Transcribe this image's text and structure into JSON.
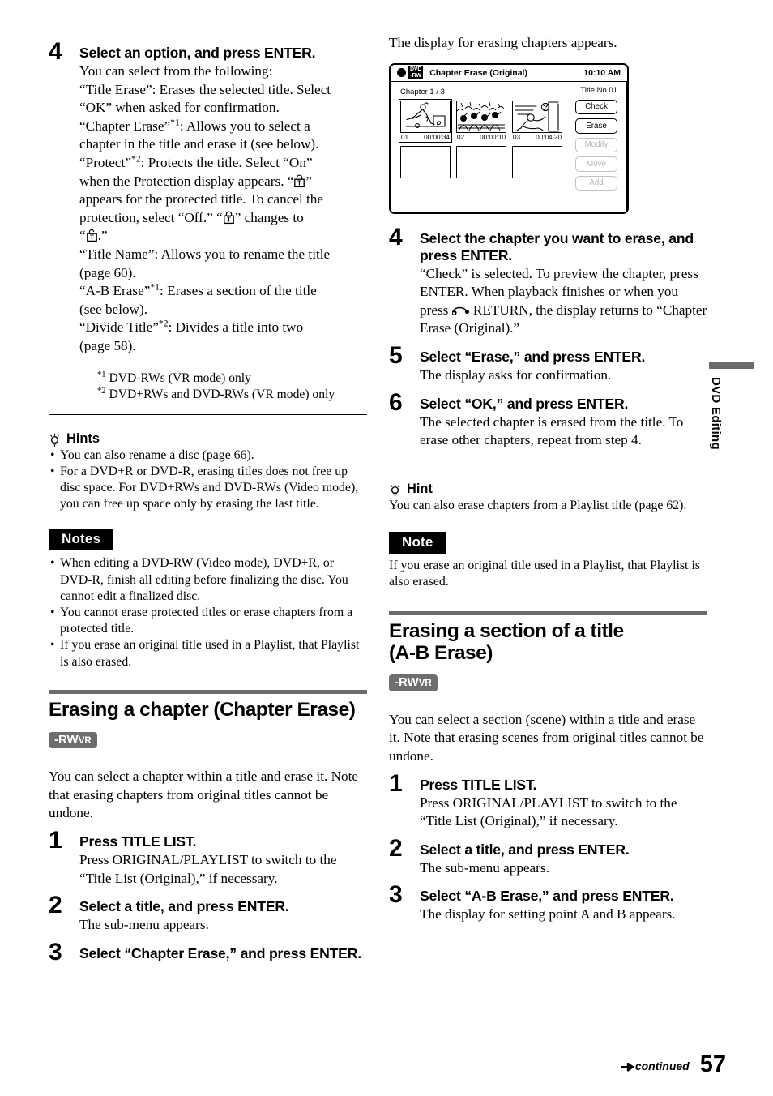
{
  "page": {
    "number": "57",
    "continued_label": "continued",
    "side_tab": "DVD Editing"
  },
  "left_column": {
    "step4": {
      "number": "4",
      "heading": "Select an option, and press ENTER.",
      "intro": "You can select from the following:",
      "options": [
        "“Title Erase”: Erases the selected title. Select “OK” when asked for confirmation.",
        "“Chapter Erase”*1: Allows you to select a chapter in the title and erase it (see below).",
        "“Protect”*2: Protects the title. Select “On” when the Protection display appears. “A” appears for the protected title. To cancel the protection, select “Off.” “A” changes to “A.”",
        "“Title Name”: Allows you to rename the title (page 60).",
        "“A-B Erase”*1: Erases a section of the title (see below).",
        "“Divide Title”*2: Divides a title into two (page 58)."
      ],
      "line_title_erase_a": "“Title Erase”: Erases the selected title. Select",
      "line_title_erase_b": "“OK” when asked for confirmation.",
      "line_chapter_erase_a1": "“Chapter Erase”",
      "line_chapter_erase_a2": ": Allows you to select a",
      "line_chapter_erase_b": "chapter in the title and erase it (see below).",
      "line_protect_a1": "“Protect”",
      "line_protect_a2": ": Protects the title. Select “On”",
      "line_protect_b": "when the Protection display appears. “",
      "line_protect_b2": "”",
      "line_protect_c": "appears for the protected title. To cancel the",
      "line_protect_d": "protection, select “Off.” “",
      "line_protect_d2": "” changes to",
      "line_protect_e1": "“",
      "line_protect_e2": ".”",
      "line_title_name_a": "“Title Name”: Allows you to rename the title",
      "line_title_name_b": "(page 60).",
      "line_ab_erase_a1": "“A-B Erase”",
      "line_ab_erase_a2": ": Erases a section of the title",
      "line_ab_erase_b": "(see below).",
      "line_divide_a1": "“Divide Title”",
      "line_divide_a2": ": Divides a title into two",
      "line_divide_b": "(page 58).",
      "sup1": "*1",
      "sup2": "*2",
      "footnote1": "DVD-RWs (VR mode) only",
      "footnote2": "DVD+RWs and DVD-RWs (VR mode) only"
    },
    "hints": {
      "heading": "Hints",
      "items": [
        "You can also rename a disc (page 66).",
        "For a DVD+R or DVD-R, erasing titles does not free up disc space. For DVD+RWs and DVD-RWs (Video mode), you can free up space only by erasing the last title."
      ]
    },
    "notes": {
      "heading": "Notes",
      "items": [
        "When editing a DVD-RW (Video mode), DVD+R, or DVD-R, finish all editing before finalizing the disc. You cannot edit a finalized disc.",
        "You cannot erase protected titles or erase chapters from a protected title.",
        "If you erase an original title used in a Playlist, that Playlist is also erased."
      ]
    },
    "section": {
      "title": "Erasing a chapter (Chapter Erase)",
      "badge_main": "-RW",
      "badge_sub": "VR",
      "intro": "You can select a chapter within a title and erase it. Note that erasing chapters from original titles cannot be undone.",
      "steps": [
        {
          "number": "1",
          "heading": "Press TITLE LIST.",
          "sub": "Press ORIGINAL/PLAYLIST to switch to the “Title List (Original),” if necessary."
        },
        {
          "number": "2",
          "heading": "Select a title, and press ENTER.",
          "sub": "The sub-menu appears."
        },
        {
          "number": "3",
          "heading": "Select “Chapter Erase,” and press ENTER.",
          "sub": ""
        }
      ]
    }
  },
  "right_column": {
    "lead_text": "The display for erasing chapters appears.",
    "osd": {
      "disc_badge_line1": "DVD",
      "disc_badge_line2": "-RW",
      "title": "Chapter Erase (Original)",
      "clock": "10:10 AM",
      "chapter_counter": "Chapter 1 / 3",
      "title_no": "Title No.01",
      "chapters": [
        {
          "no": "01",
          "time": "00:00:34",
          "art": "player",
          "selected": true
        },
        {
          "no": "02",
          "time": "00:00:10",
          "art": "crowd",
          "selected": false
        },
        {
          "no": "03",
          "time": "00:04:20",
          "art": "keeper",
          "selected": false
        }
      ],
      "buttons": [
        {
          "label": "Check",
          "enabled": true
        },
        {
          "label": "Erase",
          "enabled": true
        },
        {
          "label": "Modify",
          "enabled": false
        },
        {
          "label": "Move",
          "enabled": false
        },
        {
          "label": "Add",
          "enabled": false
        }
      ]
    },
    "steps": [
      {
        "number": "4",
        "heading": "Select the chapter you want to erase, and press ENTER.",
        "sub_a": "“Check” is selected. To preview the chapter, press ENTER. When playback finishes or when you press",
        "sub_b": "RETURN, the display returns to “Chapter Erase (Original).”"
      },
      {
        "number": "5",
        "heading": "Select “Erase,” and press ENTER.",
        "sub": "The display asks for confirmation."
      },
      {
        "number": "6",
        "heading": "Select “OK,” and press ENTER.",
        "sub": "The selected chapter is erased from the title. To erase other chapters, repeat from step 4."
      }
    ],
    "hint": {
      "heading": "Hint",
      "body": "You can also erase chapters from a Playlist title (page 62)."
    },
    "note": {
      "heading": "Note",
      "body": "If you erase an original title used in a Playlist, that Playlist is also erased."
    },
    "section": {
      "title_line1": "Erasing a section of a title",
      "title_line2": "(A-B Erase)",
      "badge_main": "-RW",
      "badge_sub": "VR",
      "intro": "You can select a section (scene) within a title and erase it. Note that erasing scenes from original titles cannot be undone.",
      "steps": [
        {
          "number": "1",
          "heading": "Press TITLE LIST.",
          "sub": "Press ORIGINAL/PLAYLIST to switch to the “Title List (Original),” if necessary."
        },
        {
          "number": "2",
          "heading": "Select a title, and press ENTER.",
          "sub": "The sub-menu appears."
        },
        {
          "number": "3",
          "heading": "Select “A-B Erase,” and press ENTER.",
          "sub": "The display for setting point A and B appears."
        }
      ]
    }
  }
}
